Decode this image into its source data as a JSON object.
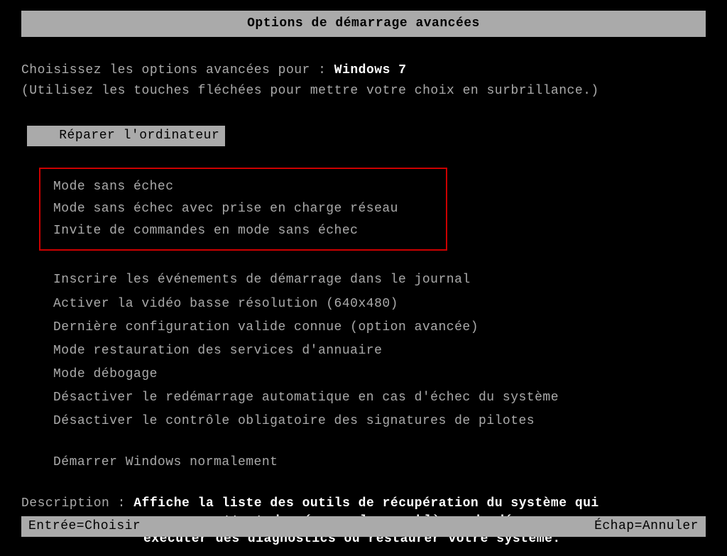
{
  "title": "Options de démarrage avancées",
  "instruction": {
    "prefix": "Choisissez les options avancées pour : ",
    "os": "Windows 7"
  },
  "hint": "(Utilisez les touches fléchées pour mettre votre choix en surbrillance.)",
  "selected": "Réparer l'ordinateur",
  "safe_modes": {
    "0": "Mode sans échec",
    "1": "Mode sans échec avec prise en charge réseau",
    "2": "Invite de commandes en mode sans échec"
  },
  "options": {
    "0": "Inscrire les événements de démarrage dans le journal",
    "1": "Activer la vidéo basse résolution (640x480)",
    "2": "Dernière configuration valide connue (option avancée)",
    "3": "Mode restauration des services d'annuaire",
    "4": "Mode débogage",
    "5": "Désactiver le redémarrage automatique en cas d'échec du système",
    "6": "Désactiver le contrôle obligatoire des signatures de pilotes"
  },
  "normal_start": "Démarrer Windows normalement",
  "description": {
    "label": "Description : ",
    "line1": "Affiche la liste des outils de récupération du système qui",
    "line2": "vous permettent de réparer les problèmes de démarrage,",
    "line3": "exécuter des diagnostics ou restaurer votre système."
  },
  "footer": {
    "enter": "Entrée=Choisir",
    "escape": "Échap=Annuler"
  }
}
